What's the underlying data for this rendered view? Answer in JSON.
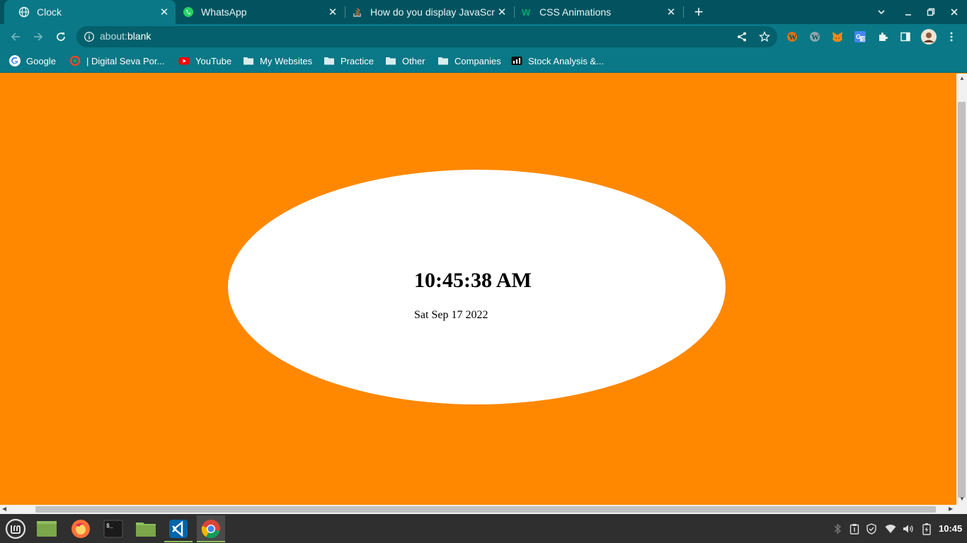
{
  "tabs": [
    {
      "title": "Clock",
      "icon": "globe-icon"
    },
    {
      "title": "WhatsApp",
      "icon": "whatsapp-icon"
    },
    {
      "title": "How do you display JavaScript",
      "icon": "stackoverflow-icon"
    },
    {
      "title": "CSS Animations",
      "icon": "w3schools-icon"
    }
  ],
  "address_bar": {
    "scheme": "about:",
    "path": "blank"
  },
  "bookmarks": [
    {
      "label": "Google",
      "icon": "google-icon"
    },
    {
      "label": "| Digital Seva Por...",
      "icon": "digital-seva-icon"
    },
    {
      "label": "YouTube",
      "icon": "youtube-icon"
    },
    {
      "label": "My Websites",
      "icon": "folder-icon"
    },
    {
      "label": "Practice",
      "icon": "folder-icon"
    },
    {
      "label": "Other",
      "icon": "folder-icon"
    },
    {
      "label": "Companies",
      "icon": "folder-icon"
    },
    {
      "label": "Stock Analysis &...",
      "icon": "stock-analysis-icon"
    }
  ],
  "page": {
    "time": "10:45:38 AM",
    "date": "Sat Sep 17 2022",
    "background_color": "#ff8800",
    "ellipse_color": "#ffffff"
  },
  "taskbar": {
    "apps": [
      "mint-menu-icon",
      "show-desktop-icon",
      "firefox-icon",
      "terminal-icon",
      "files-icon",
      "vscode-icon",
      "chrome-icon"
    ],
    "clock": "10:45"
  },
  "colors": {
    "tabstrip": "#02535f",
    "toolbar": "#0a7886",
    "page_bg": "#ff8800"
  }
}
